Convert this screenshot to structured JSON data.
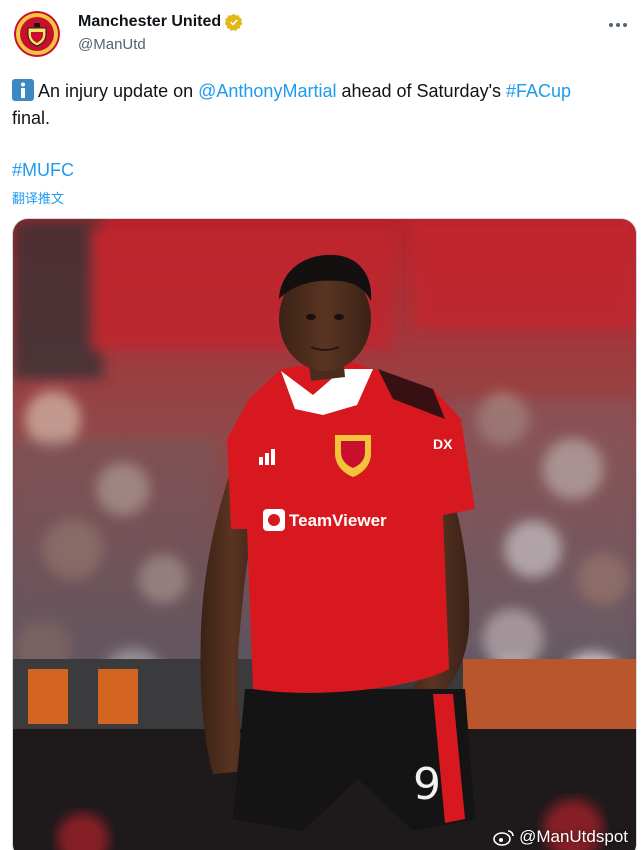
{
  "author": {
    "display_name": "Manchester United",
    "handle": "@ManUtd",
    "verified_color": "#e2b719",
    "avatar_icon": "man-utd-crest"
  },
  "tweet": {
    "info_emoji": "information-icon",
    "text_before": "An injury update on ",
    "mention": "@AnthonyMartial",
    "text_middle": " ahead of Saturday's ",
    "hashtag_facup": "#FACup",
    "text_after": "final.",
    "hashtag_mufc": "#MUFC",
    "translate_label": "翻译推文"
  },
  "media": {
    "description_icon": "player-photo",
    "shirt_sponsor": "TeamViewer",
    "shirt_number": "9",
    "kit_brand": "adidas",
    "watermark": "@ManUtdspot"
  },
  "colors": {
    "link": "#1d9bf0",
    "text": "#0f1419",
    "secondary": "#536471",
    "border": "#cfd9de",
    "kit_red": "#d7191f"
  }
}
